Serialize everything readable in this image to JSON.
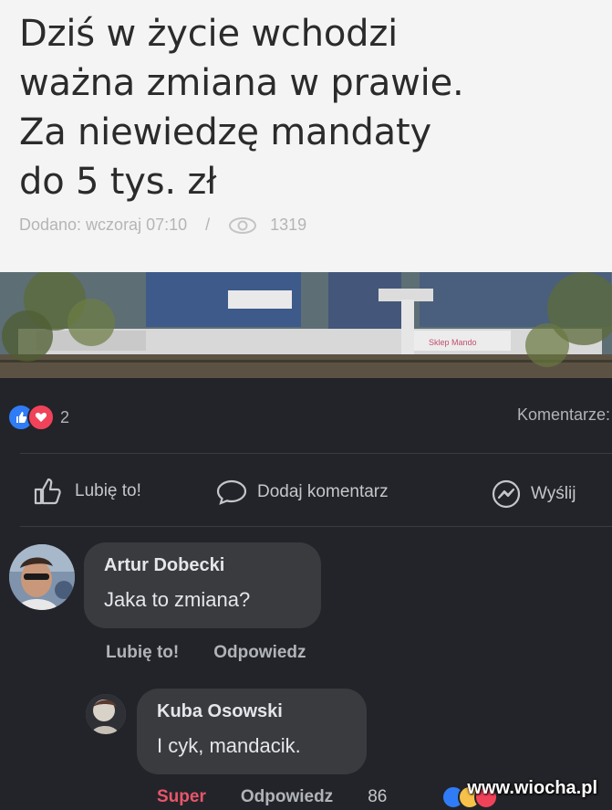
{
  "article": {
    "headline": "Dziś w życie wchodzi\nważna zmiana w prawie.\nZa niewiedzę mandaty\ndo 5 tys. zł",
    "added_label": "Dodano: wczoraj 07:10",
    "separator": "/",
    "views": "1319",
    "photo_sign_text": "Sklep Mando"
  },
  "post": {
    "reaction_count": "2",
    "comments_label": "Komentarze:",
    "actions": {
      "like": "Lubię to!",
      "comment": "Dodaj komentarz",
      "send": "Wyślij"
    }
  },
  "comments": [
    {
      "author": "Artur Dobecki",
      "text": "Jaka to zmiana?",
      "like_label": "Lubię to!",
      "reply_label": "Odpowiedz"
    },
    {
      "author": "Kuba Osowski",
      "text": "I cyk, mandacik.",
      "reaction_label": "Super",
      "reply_label": "Odpowiedz",
      "reaction_count": "86"
    }
  ],
  "watermark": "www.wiocha.pl",
  "colors": {
    "fb_background": "#232429",
    "bubble": "#3a3b3f",
    "like_blue": "#2f7cf6",
    "love_red": "#f0435a",
    "super_red": "#e8566a"
  }
}
